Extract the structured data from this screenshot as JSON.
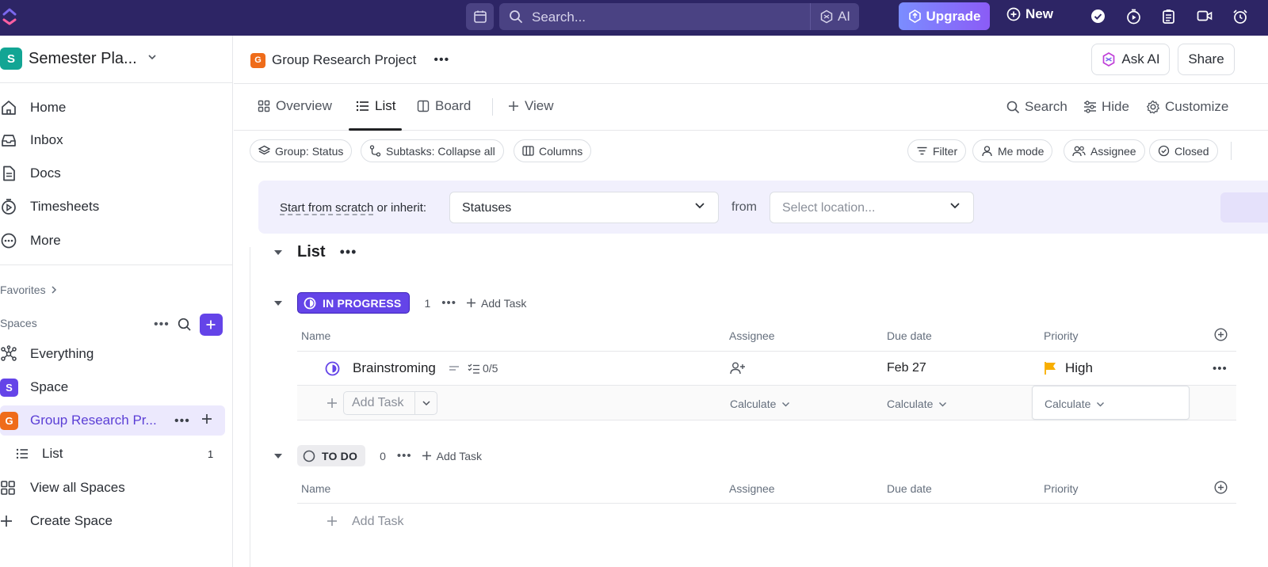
{
  "topbar": {
    "search_placeholder": "Search...",
    "ai_label": "AI",
    "upgrade_label": "Upgrade",
    "new_label": "New"
  },
  "sidebar": {
    "workspace": {
      "initial": "S",
      "name": "Semester Pla...",
      "color": "#12a594"
    },
    "nav": [
      {
        "label": "Home",
        "icon": "home-icon"
      },
      {
        "label": "Inbox",
        "icon": "inbox-icon"
      },
      {
        "label": "Docs",
        "icon": "docs-icon"
      },
      {
        "label": "Timesheets",
        "icon": "timesheets-icon"
      },
      {
        "label": "More",
        "icon": "more-icon"
      }
    ],
    "favorites_label": "Favorites",
    "spaces_label": "Spaces",
    "spaces": [
      {
        "label": "Everything",
        "icon": "everything-icon"
      },
      {
        "label": "Space",
        "initial": "S",
        "color": "#6444e8"
      },
      {
        "label": "Group Research Pr...",
        "initial": "G",
        "color": "#ef6c1a",
        "active": true
      },
      {
        "label": "List",
        "count": "1",
        "icon": "list-icon"
      },
      {
        "label": "View all Spaces",
        "icon": "grid-icon"
      },
      {
        "label": "Create Space",
        "icon": "plus-icon"
      }
    ]
  },
  "header": {
    "project_initial": "G",
    "project_name": "Group Research Project",
    "ask_ai_label": "Ask AI",
    "share_label": "Share"
  },
  "tabs": {
    "items": [
      {
        "label": "Overview"
      },
      {
        "label": "List",
        "active": true
      },
      {
        "label": "Board"
      }
    ],
    "add_view_label": "View",
    "search_label": "Search",
    "hide_label": "Hide",
    "customize_label": "Customize"
  },
  "filters": {
    "group": "Group: Status",
    "subtasks": "Subtasks: Collapse all",
    "columns": "Columns",
    "filter": "Filter",
    "me_mode": "Me mode",
    "assignee": "Assignee",
    "closed": "Closed"
  },
  "banner": {
    "lead_link": "Start from scratch",
    "lead_rest": " or inherit:",
    "statuses_value": "Statuses",
    "from_label": "from",
    "location_placeholder": "Select location..."
  },
  "list": {
    "title": "List",
    "columns": {
      "name": "Name",
      "assignee": "Assignee",
      "due": "Due date",
      "priority": "Priority"
    },
    "add_task": "Add Task",
    "groups": [
      {
        "status": "IN PROGRESS",
        "count": "1",
        "color": "#6444e8",
        "tasks": [
          {
            "name": "Brainstroming",
            "subtasks": "0/5",
            "due": "Feb 27",
            "priority": "High",
            "priority_color": "#f8ae00"
          }
        ],
        "calc_label": "Calculate"
      },
      {
        "status": "TO DO",
        "count": "0",
        "color": "#87909e",
        "tasks": []
      }
    ]
  }
}
